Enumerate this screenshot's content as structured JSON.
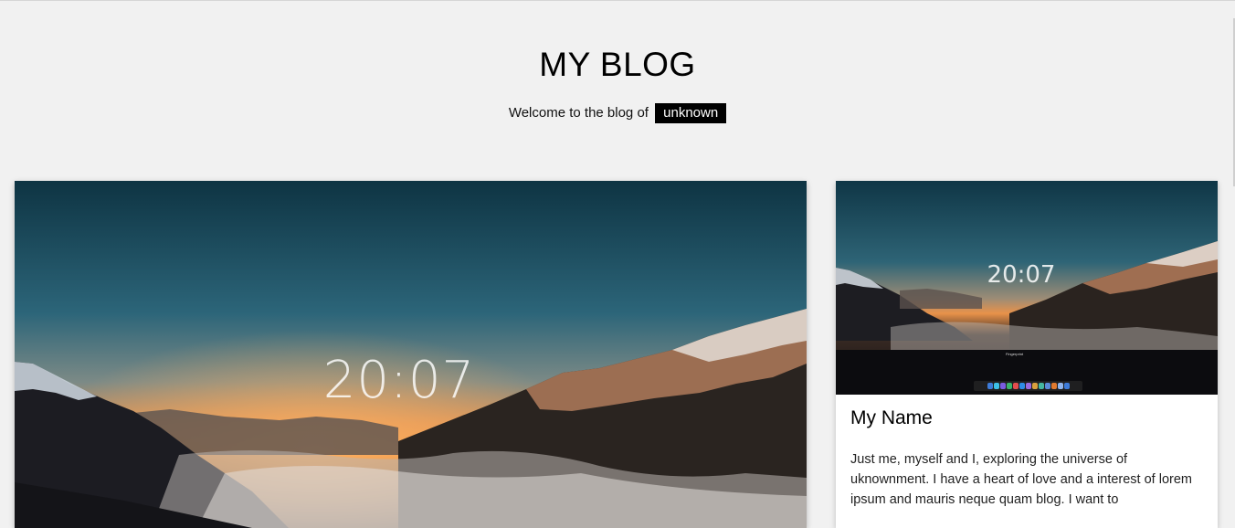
{
  "header": {
    "title": "MY BLOG",
    "welcome_text": "Welcome to the blog of",
    "name_tag": "unknown"
  },
  "main_post": {
    "clock": "20:07",
    "image_alt": "mountain-sunset"
  },
  "sidebar_card": {
    "clock": "20:07",
    "fingerprint_label": "Fingerprint",
    "heading": "My Name",
    "text": "Just me, myself and I, exploring the universe of uknownment. I have a heart of love and a interest of lorem ipsum and mauris neque quam blog. I want to"
  },
  "colors": {
    "background": "#f1f1f1",
    "name_tag_bg": "#000000",
    "name_tag_text": "#ffffff",
    "sky_top": "#0f3a4a",
    "sky_horizon": "#e8954e"
  }
}
